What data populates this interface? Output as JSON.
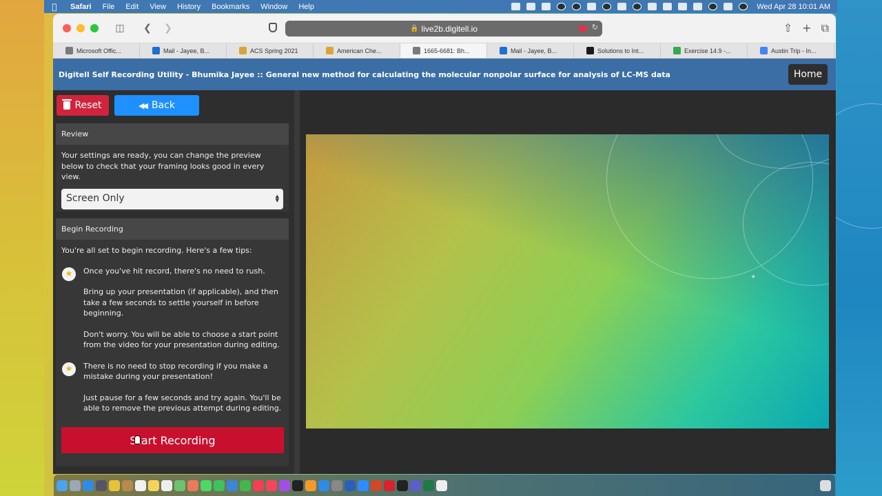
{
  "menubar": {
    "app": "Safari",
    "items": [
      "File",
      "Edit",
      "View",
      "History",
      "Bookmarks",
      "Window",
      "Help"
    ],
    "clock": "Wed Apr 28  10:01 AM"
  },
  "browser": {
    "url": "live2b.digitell.io",
    "tabs": [
      {
        "label": "Microsoft Offic...",
        "color": "#7a7a7a"
      },
      {
        "label": "Mail - Jayee, B...",
        "color": "#1e6fd1"
      },
      {
        "label": "ACS Spring 2021",
        "color": "#d9a43b"
      },
      {
        "label": "American Che...",
        "color": "#d9a43b"
      },
      {
        "label": "1665-6681: Bh...",
        "color": "#7a7a7a"
      },
      {
        "label": "Mail - Jayee, B...",
        "color": "#1e6fd1"
      },
      {
        "label": "Solutions to Int...",
        "color": "#1b1b1b"
      },
      {
        "label": "Exercise 14.9 -...",
        "color": "#34a853"
      },
      {
        "label": "Austin Trip - In...",
        "color": "#4285f4"
      }
    ],
    "active_tab": 4
  },
  "app": {
    "title": "Digitell Self Recording Utility - Bhumika Jayee :: General new method for calculating the molecular nonpolar surface for analysis of LC-MS data",
    "home_label": "Home",
    "reset_label": "Reset",
    "back_label": "Back"
  },
  "review": {
    "heading": "Review",
    "text": "Your settings are ready, you can change the preview below to check that your framing looks good in every view.",
    "selected_view": "Screen Only"
  },
  "begin": {
    "heading": "Begin Recording",
    "intro": "You're all set to begin recording. Here's a few tips:",
    "tip1_title": "Once you've hit record, there's no need to rush.",
    "tip1_p2": "Bring up your presentation (if applicable), and then take a few seconds to settle yourself in before beginning.",
    "tip1_p3": "Don't worry. You will be able to choose a start point from the video for your presentation during editing.",
    "tip2_title": "There is no need to stop recording if you make a mistake during your presentation!",
    "tip2_p2": "Just pause for a few seconds and try again. You'll be able to remove the previous attempt during editing.",
    "start_label": "Start Recording"
  },
  "colors": {
    "accent_blue": "#1e90ff",
    "danger_red": "#d0243c",
    "header_blue": "#3a6ea5"
  }
}
